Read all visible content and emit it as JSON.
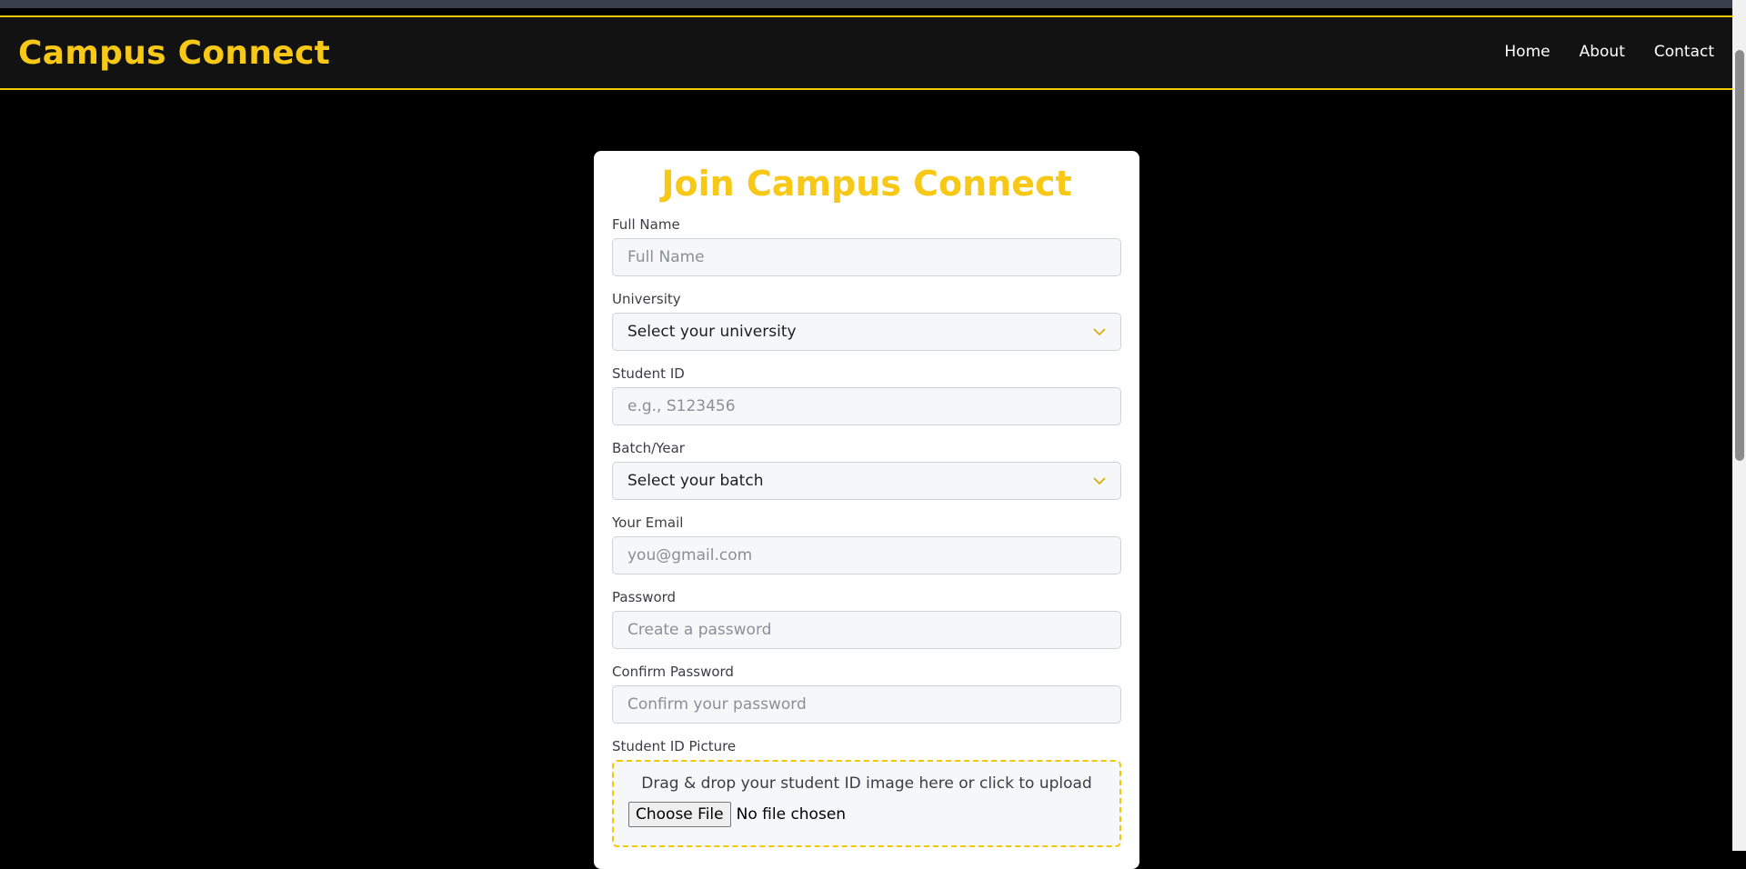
{
  "nav": {
    "brand": "Campus Connect",
    "links": [
      "Home",
      "About",
      "Contact"
    ]
  },
  "form": {
    "title": "Join Campus Connect",
    "full_name": {
      "label": "Full Name",
      "placeholder": "Full Name"
    },
    "university": {
      "label": "University",
      "selected": "Select your university"
    },
    "student_id": {
      "label": "Student ID",
      "placeholder": "e.g., S123456"
    },
    "batch": {
      "label": "Batch/Year",
      "selected": "Select your batch"
    },
    "email": {
      "label": "Your Email",
      "placeholder": "you@gmail.com"
    },
    "password": {
      "label": "Password",
      "placeholder": "Create a password"
    },
    "confirm_password": {
      "label": "Confirm Password",
      "placeholder": "Confirm your password"
    },
    "id_picture": {
      "label": "Student ID Picture",
      "drop_text": "Drag & drop your student ID image here or click to upload",
      "button": "Choose File",
      "status": "No file chosen"
    }
  },
  "colors": {
    "accent": "#f7c815",
    "background": "#000000",
    "navbar": "#121212"
  }
}
